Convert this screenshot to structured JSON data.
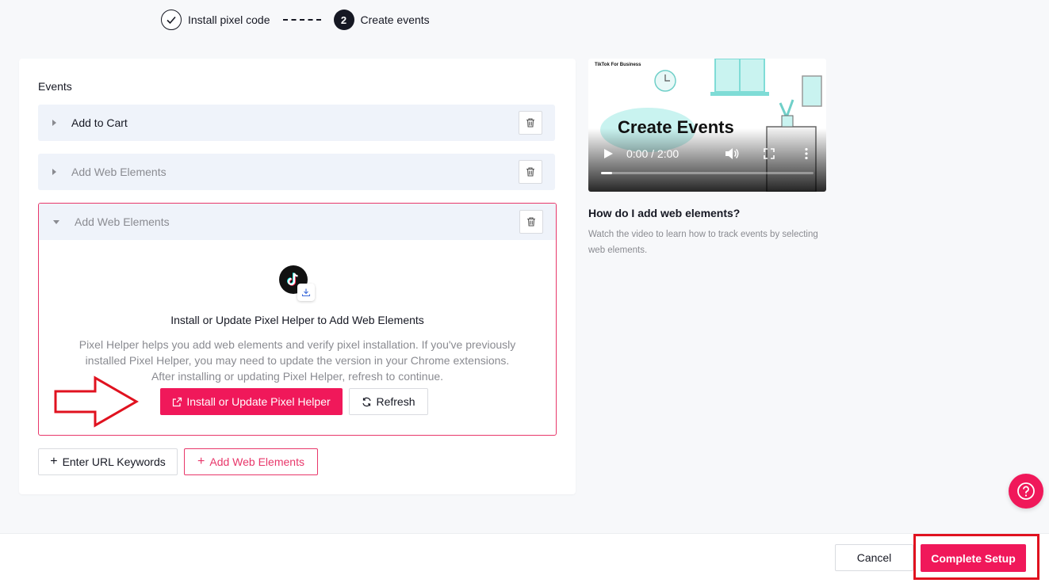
{
  "stepper": {
    "step1_label": "Install pixel code",
    "step2_number": "2",
    "step2_label": "Create events"
  },
  "events": {
    "title": "Events",
    "items": [
      {
        "label": "Add to Cart",
        "expanded": false
      },
      {
        "label": "Add Web Elements",
        "expanded": false
      },
      {
        "label": "Add Web Elements",
        "expanded": true
      }
    ]
  },
  "pixel_helper": {
    "title": "Install or Update Pixel Helper to Add Web Elements",
    "description": "Pixel Helper helps you add web elements and verify pixel installation. If you've previously installed Pixel Helper, you may need to update the version in your Chrome extensions. After installing or updating Pixel Helper, refresh to continue.",
    "install_button": "Install or Update Pixel Helper",
    "refresh_button": "Refresh"
  },
  "actions": {
    "enter_url_keywords": "Enter URL Keywords",
    "add_web_elements": "Add Web Elements"
  },
  "video": {
    "brand": "TikTok For Business",
    "title": "Create Events",
    "time": "0:00 / 2:00",
    "progress_fraction": 0.0
  },
  "sidebar": {
    "title": "How do I add web elements?",
    "description": "Watch the video to learn how to track events by selecting web elements."
  },
  "footer": {
    "cancel": "Cancel",
    "complete": "Complete Setup"
  },
  "colors": {
    "accent": "#f0185a",
    "highlight": "#e0121f"
  }
}
